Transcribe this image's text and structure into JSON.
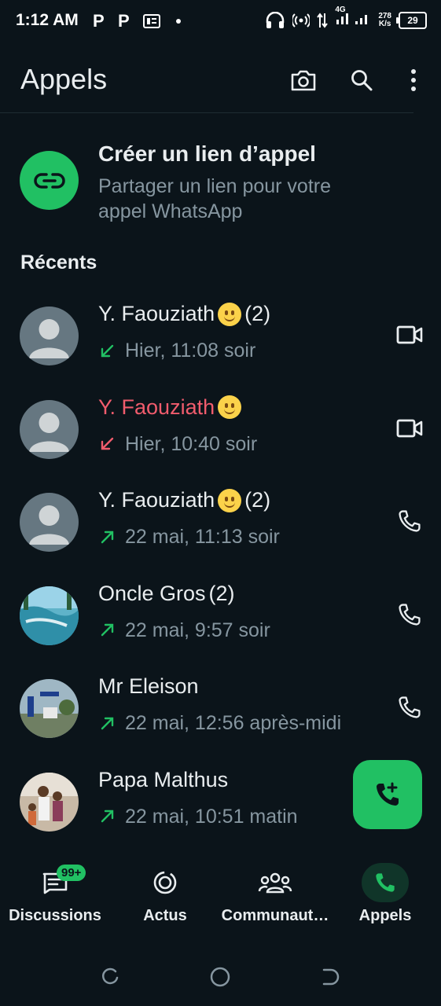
{
  "status_bar": {
    "time": "1:12 AM",
    "network_type": "4G",
    "speed_value": "278",
    "speed_unit": "K/s",
    "battery": "29"
  },
  "header": {
    "title": "Appels",
    "icons": [
      "camera-icon",
      "search-icon",
      "more-options-icon"
    ]
  },
  "create_link": {
    "title": "Créer un lien d’appel",
    "subtitle": "Partager un lien pour votre appel WhatsApp",
    "icon": "link-icon"
  },
  "section_title": "Récents",
  "calls": [
    {
      "name": "Y. Faouziath",
      "emoji": "smiling-face",
      "count": "(2)",
      "missed": false,
      "direction": "incoming",
      "time": "Hier, 11:08 soir",
      "type": "video",
      "avatar": "default"
    },
    {
      "name": "Y. Faouziath",
      "emoji": "smiling-face",
      "count": "",
      "missed": true,
      "direction": "incoming",
      "time": "Hier, 10:40 soir",
      "type": "video",
      "avatar": "default"
    },
    {
      "name": "Y. Faouziath",
      "emoji": "smiling-face",
      "count": "(2)",
      "missed": false,
      "direction": "outgoing",
      "time": "22 mai, 11:13 soir",
      "type": "voice",
      "avatar": "default"
    },
    {
      "name": "Oncle Gros",
      "emoji": "",
      "count": "(2)",
      "missed": false,
      "direction": "outgoing",
      "time": "22 mai, 9:57 soir",
      "type": "voice",
      "avatar": "photo-pool"
    },
    {
      "name": "Mr Eleison",
      "emoji": "",
      "count": "",
      "missed": false,
      "direction": "outgoing",
      "time": "22 mai, 12:56 après-midi",
      "type": "voice",
      "avatar": "photo-outdoor"
    },
    {
      "name": "Papa Malthus",
      "emoji": "",
      "count": "",
      "missed": false,
      "direction": "outgoing",
      "time": "22 mai, 10:51 matin",
      "type": "voice",
      "avatar": "photo-people"
    }
  ],
  "fab": {
    "icon": "add-call-icon"
  },
  "bottom_nav": [
    {
      "label": "Discussions",
      "icon": "chat-icon",
      "badge": "99+",
      "active": false
    },
    {
      "label": "Actus",
      "icon": "updates-icon",
      "badge": "",
      "active": false
    },
    {
      "label": "Communaut…",
      "icon": "communities-icon",
      "badge": "",
      "active": false
    },
    {
      "label": "Appels",
      "icon": "phone-icon",
      "badge": "",
      "active": true
    }
  ],
  "colors": {
    "background": "#0b141a",
    "accent": "#21c063",
    "missed": "#f15c6d",
    "secondary_text": "#8696a0"
  }
}
